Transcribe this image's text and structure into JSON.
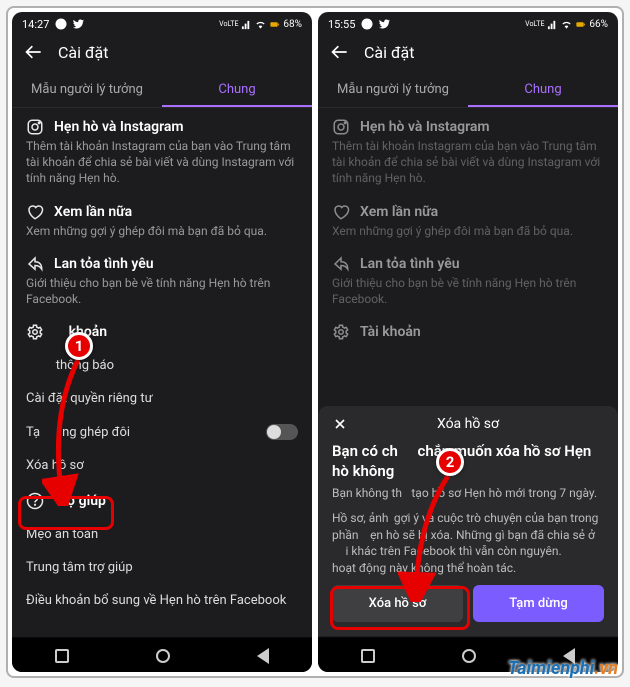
{
  "status1": {
    "time": "14:27",
    "battery": "68%"
  },
  "status2": {
    "time": "15:55",
    "battery": "66%"
  },
  "header": {
    "title": "Cài đặt"
  },
  "tabs": {
    "t1": "Mẫu người lý tưởng",
    "t2": "Chung"
  },
  "sec_instagram": {
    "title": "Hẹn hò và Instagram",
    "desc": "Thêm tài khoản Instagram của bạn vào Trung tâm tài khoản để chia sẻ bài viết và dùng Instagram với tính năng Hẹn hò."
  },
  "sec_again": {
    "title": "Xem lần nữa",
    "desc": "Xem những gợi ý ghép đôi mà bạn đã bỏ qua."
  },
  "sec_spread": {
    "title": "Lan tỏa tình yêu",
    "desc": "Giới thiệu cho bạn bè về tính năng Hẹn hò trên Facebook."
  },
  "sec_account": {
    "title": "Tài khoản",
    "title_masked": "khoản",
    "items": {
      "notif": "Cài đặt thông báo",
      "notif_masked": "thông báo",
      "privacy": "Cài đặt quyền riêng tư",
      "pause": "Tạm dừng ghép đôi",
      "pause_prefix": "Tạ",
      "pause_suffix": "ng ghép đôi",
      "delete": "Xóa hồ sơ"
    }
  },
  "sec_help": {
    "title": "Trợ giúp",
    "items": {
      "safety": "Mẹo an toàn",
      "support": "Trung tâm trợ giúp",
      "terms": "Điều khoản bổ sung về Hẹn hò trên Facebook"
    }
  },
  "modal": {
    "title": "Xóa hồ sơ",
    "heading_prefix": "Bạn có ch",
    "heading_suffix_line1": "chắn muốn xóa hồ sơ Hẹn",
    "heading_line2": "hò không",
    "line1_prefix": "Bạn không th",
    "line1_suffix": "tạo hồ sơ Hẹn hò mới trong 7 ngày.",
    "line2_a": "Hồ sơ, ảnh",
    "line2_b": "gợi ý và cuộc trò chuyện của bạn trong phần",
    "line2_c": "ẹn hò sẽ bị xóa. Những gì bạn đã chia sẻ ở",
    "line2_d": "i khác trên Facebook thì vẫn còn nguyên.",
    "line2_e": "hoạt động này không thể hoàn tác.",
    "btn_delete": "Xóa hồ sơ",
    "btn_pause": "Tạm dừng"
  },
  "annot": {
    "b1": "1",
    "b2": "2"
  },
  "watermark": {
    "a": "Taimienphi",
    "b": ".vn"
  }
}
